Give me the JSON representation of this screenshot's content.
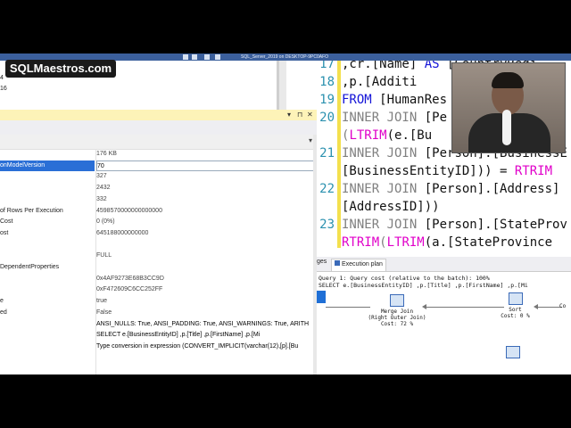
{
  "window": {
    "title": "SQL_Server_2019 on DESKTOP-9PC0AFO"
  },
  "overlay": {
    "logo": "SQLMaestros.com"
  },
  "left_top": {
    "lines": [
      "4",
      "16"
    ]
  },
  "properties": {
    "rows": [
      {
        "name": "",
        "value": "176 KB"
      },
      {
        "name": "onModelVersion",
        "value": "70",
        "selected": true
      },
      {
        "name": "",
        "value": "327"
      },
      {
        "name": "",
        "value": "2432"
      },
      {
        "name": "",
        "value": "332"
      },
      {
        "name": "of Rows Per Execution",
        "value": "4598570000000000000"
      },
      {
        "name": "Cost",
        "value": "0 (0%)"
      },
      {
        "name": "ost",
        "value": "645188000000000"
      },
      {
        "name": "",
        "value": ""
      },
      {
        "name": "",
        "value": "FULL"
      },
      {
        "name": "DependentProperties",
        "value": ""
      },
      {
        "name": "",
        "value": "0x4AF9273E68B3CC9D"
      },
      {
        "name": "",
        "value": "0xF472609C6CC252FF"
      },
      {
        "name": "e",
        "value": "true"
      },
      {
        "name": "ed",
        "value": "False"
      },
      {
        "name": "",
        "value": "ANSI_NULLS: True, ANSI_PADDING: True, ANSI_WARNINGS: True, ARITH"
      },
      {
        "name": "",
        "value": "SELECT e.[BusinessEntityID]       ,p.[Title]     ,p.[FirstName]          ,p.[Mi"
      },
      {
        "name": "",
        "value": "Type conversion in expression (CONVERT_IMPLICIT(varchar(12),[p].[Bu"
      }
    ]
  },
  "editor": {
    "line_numbers": [
      "17",
      "18",
      "19",
      "20",
      "21",
      "22",
      "23"
    ],
    "lines": [
      {
        "parts": [
          {
            "t": "    ,cr.[Name] ",
            "c": "plain"
          },
          {
            "t": "AS",
            "c": "kw"
          },
          {
            "t": " [CountryRegi",
            "c": "plain"
          }
        ]
      },
      {
        "parts": [
          {
            "t": "    ,p.[Additi",
            "c": "plain"
          }
        ]
      },
      {
        "parts": [
          {
            "t": "FROM",
            "c": "kw"
          },
          {
            "t": " [HumanRes",
            "c": "plain"
          }
        ]
      },
      {
        "parts": [
          {
            "t": "INNER JOIN",
            "c": "gr"
          },
          {
            "t": " [Pe",
            "c": "plain"
          }
        ]
      },
      {
        "parts": [
          {
            "t": "  (",
            "c": "gr"
          },
          {
            "t": "LTRIM",
            "c": "fn"
          },
          {
            "t": "(e.[Bu",
            "c": "plain"
          }
        ]
      },
      {
        "parts": [
          {
            "t": "INNER JOIN",
            "c": "gr"
          },
          {
            "t": " [Person].[BusinessE",
            "c": "plain"
          }
        ]
      },
      {
        "parts": [
          {
            "t": "  [BusinessEntityID])) = ",
            "c": "plain"
          },
          {
            "t": "RTRIM",
            "c": "fn"
          }
        ]
      },
      {
        "parts": [
          {
            "t": "INNER JOIN",
            "c": "gr"
          },
          {
            "t": " [Person].[Address] ",
            "c": "plain"
          }
        ]
      },
      {
        "parts": [
          {
            "t": "  [AddressID]))",
            "c": "plain"
          }
        ]
      },
      {
        "parts": [
          {
            "t": "INNER JOIN",
            "c": "gr"
          },
          {
            "t": " [Person].[StateProv",
            "c": "plain"
          }
        ]
      },
      {
        "parts": [
          {
            "t": "  ",
            "c": "plain"
          },
          {
            "t": "RTRIM",
            "c": "fn"
          },
          {
            "t": "(",
            "c": "gr"
          },
          {
            "t": "LTRIM",
            "c": "fn"
          },
          {
            "t": "(a.[StateProvince",
            "c": "plain"
          }
        ]
      }
    ]
  },
  "plan": {
    "tabs": [
      "ges",
      "Execution plan"
    ],
    "query_header": "Query 1: Query cost (relative to the batch): 100%",
    "query_text": "SELECT e.[BusinessEntityID] ,p.[Title] ,p.[FirstName] ,p.[Mi",
    "ops": [
      {
        "name": "Merge Join",
        "sub": "(Right Outer Join)",
        "cost": "Cost: 72 %"
      },
      {
        "name": "Sort",
        "sub": "",
        "cost": "Cost: 0 %"
      },
      {
        "name": "Co",
        "sub": "",
        "cost": ""
      }
    ]
  }
}
